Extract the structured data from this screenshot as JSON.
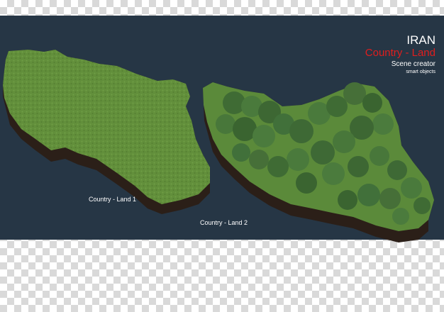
{
  "header": {
    "country": "IRAN",
    "subtitle": "Country - Land",
    "product": "Scene creator",
    "tagline": "smart objects"
  },
  "labels": {
    "land1": "Country - Land 1",
    "land2": "Country - Land 2"
  },
  "colors": {
    "stage_background": "#263645",
    "accent_red": "#e01e1e",
    "grass": "#5f8f3a",
    "forest": "#3f6b34",
    "soil": "#2a1e18"
  }
}
